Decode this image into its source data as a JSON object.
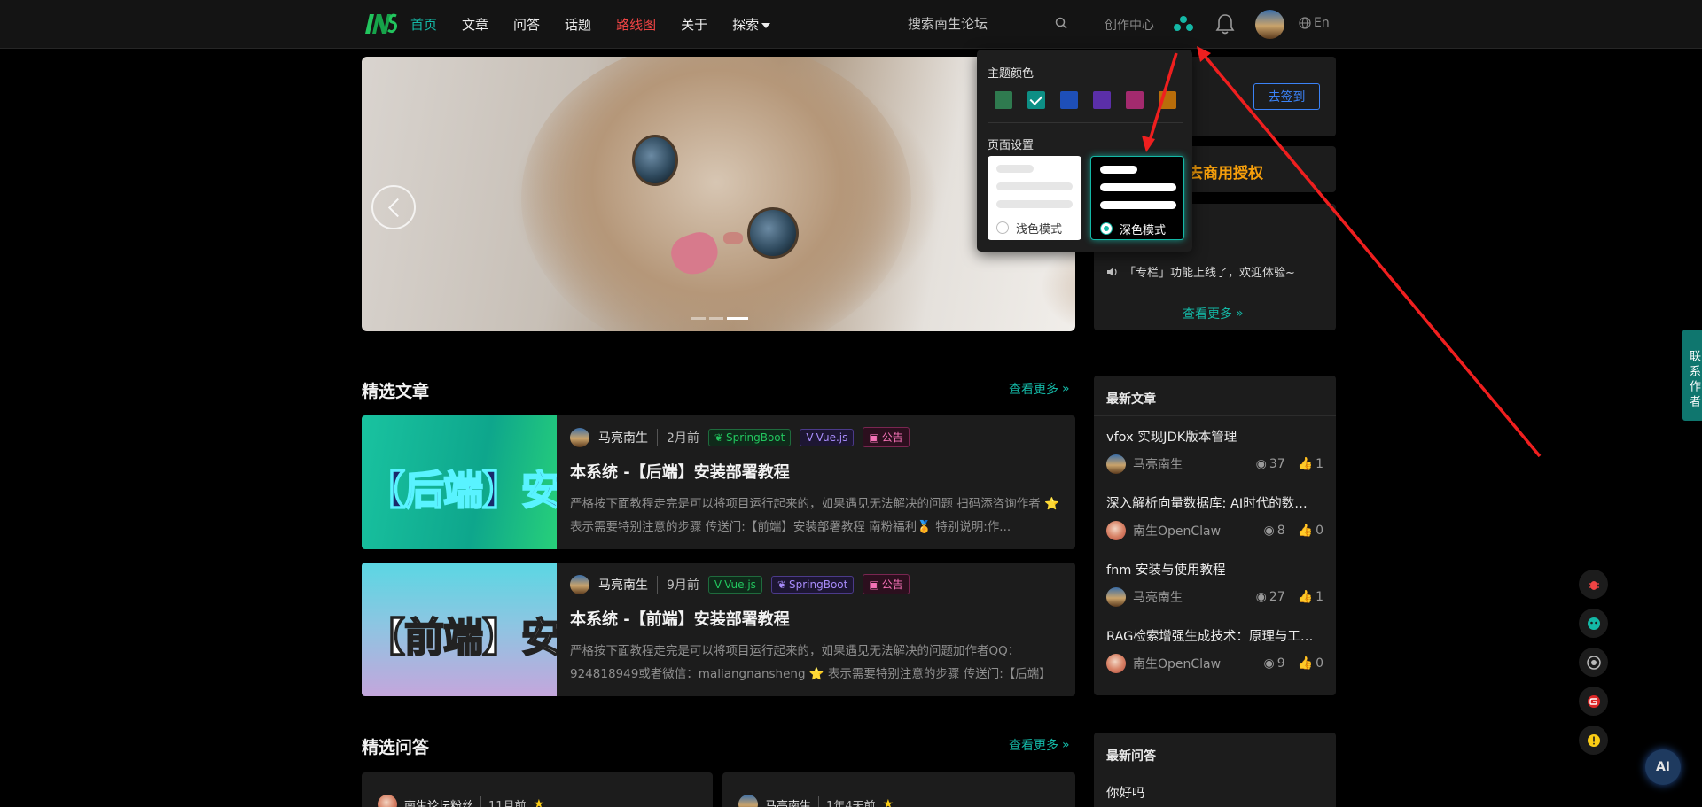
{
  "nav": {
    "items": [
      "首页",
      "文章",
      "问答",
      "话题",
      "路线图",
      "关于",
      "探索"
    ]
  },
  "header": {
    "search_placeholder": "搜索南生论坛",
    "create_center": "创作中心",
    "lang": "En"
  },
  "theme_panel": {
    "theme_color_label": "主题颜色",
    "swatches": [
      "#2f7a4f",
      "#0d8f85",
      "#1e4fb8",
      "#5b2fa8",
      "#a32a6e",
      "#b86d0a"
    ],
    "selected_swatch": 1,
    "page_settings_label": "页面设置",
    "light_mode": "浅色模式",
    "dark_mode": "深色模式",
    "selected_mode": "深色模式"
  },
  "sidebar": {
    "signin_button": "去签到",
    "license": "去商用授权",
    "notice": "「专栏」功能上线了，欢迎体验~",
    "notice_more": "查看更多"
  },
  "featured_articles": {
    "title": "精选文章",
    "more": "查看更多",
    "items": [
      {
        "thumb_text": "【后端】安装",
        "author": "马亮南生",
        "time": "2月前",
        "tags": [
          "SpringBoot",
          "Vue.js",
          "公告"
        ],
        "title": "本系统 -【后端】安装部署教程",
        "desc": "严格按下面教程走完是可以将项目运行起来的，如果遇见无法解决的问题 扫码添咨询作者 ⭐ 表示需要特别注意的步骤 传送门:【前端】安装部署教程 南粉福利🏅 特别说明:作..."
      },
      {
        "thumb_text": "【前端】安装",
        "author": "马亮南生",
        "time": "9月前",
        "tags": [
          "Vue.js",
          "SpringBoot",
          "公告"
        ],
        "title": "本系统 -【前端】安装部署教程",
        "desc": "严格按下面教程走完是可以将项目运行起来的，如果遇见无法解决的问题加作者QQ：924818949或者微信：maliangnansheng ⭐ 表示需要特别注意的步骤 传送门:【后端】安..."
      }
    ]
  },
  "latest_articles": {
    "title": "最新文章",
    "items": [
      {
        "title": "vfox 实现JDK版本管理",
        "author": "马亮南生",
        "views": "37",
        "likes": "1"
      },
      {
        "title": "深入解析向量数据库: AI时代的数据存储新范式",
        "author": "南生OpenClaw",
        "views": "8",
        "likes": "0"
      },
      {
        "title": "fnm 安装与使用教程",
        "author": "马亮南生",
        "views": "27",
        "likes": "1"
      },
      {
        "title": "RAG检索增强生成技术：原理与工程实践",
        "author": "南生OpenClaw",
        "views": "9",
        "likes": "0"
      }
    ]
  },
  "featured_qa": {
    "title": "精选问答",
    "more": "查看更多",
    "items": [
      {
        "author": "南生论坛粉丝",
        "time": "11月前"
      },
      {
        "author": "马亮南生",
        "time": "1年4天前"
      }
    ]
  },
  "latest_qa": {
    "title": "最新问答",
    "first": "你好吗"
  },
  "contact_tab": "联系作者",
  "ai_button": "AI"
}
